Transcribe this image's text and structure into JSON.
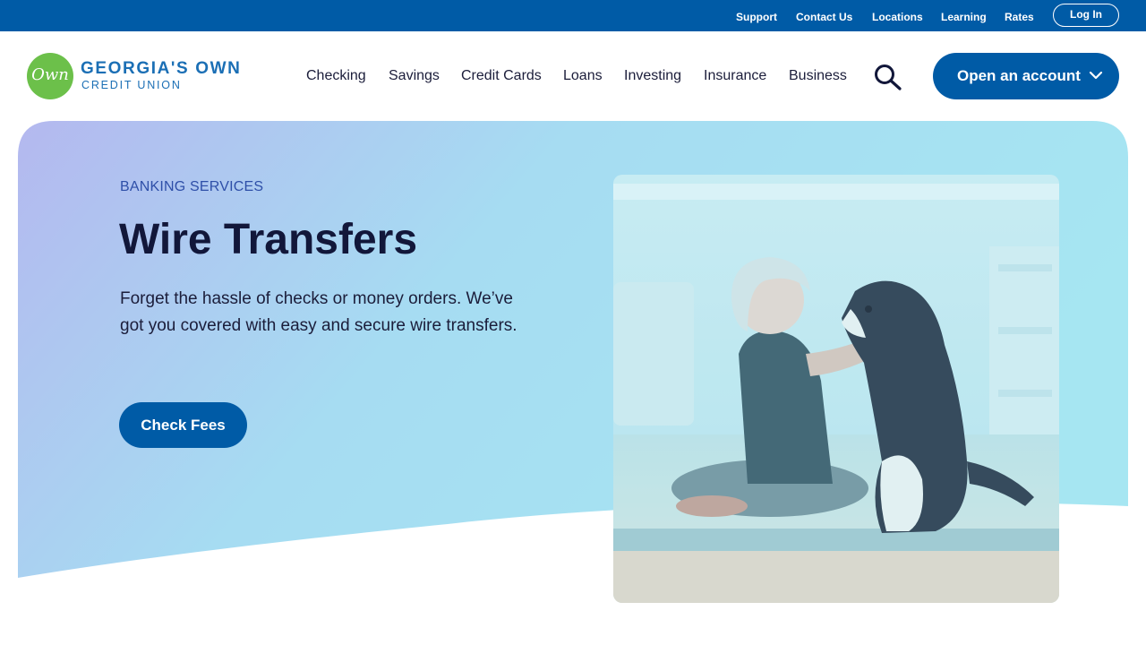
{
  "utility_nav": {
    "links": [
      "Support",
      "Contact Us",
      "Locations",
      "Learning",
      "Rates"
    ],
    "login_label": "Log In"
  },
  "brand": {
    "logo_mark": "Own",
    "name_line1": "GEORGIA'S OWN",
    "name_line2": "CREDIT UNION"
  },
  "main_nav": {
    "items": [
      "Checking",
      "Savings",
      "Credit Cards",
      "Loans",
      "Investing",
      "Insurance",
      "Business"
    ],
    "search_icon": "search-icon",
    "cta_label": "Open an account",
    "cta_icon": "chevron-down-icon"
  },
  "hero": {
    "eyebrow": "BANKING SERVICES",
    "title": "Wire Transfers",
    "description": "Forget the hassle of checks or money orders. We’ve got you covered with easy and secure wire transfers.",
    "button_label": "Check Fees"
  },
  "colors": {
    "brand_blue": "#005ba6",
    "logo_green": "#6cc04a",
    "hero_gradient_start": "#b4b8ef",
    "hero_gradient_end": "#a6e6f2",
    "title_text": "#12173a",
    "eyebrow_text": "#2e4fa8"
  }
}
